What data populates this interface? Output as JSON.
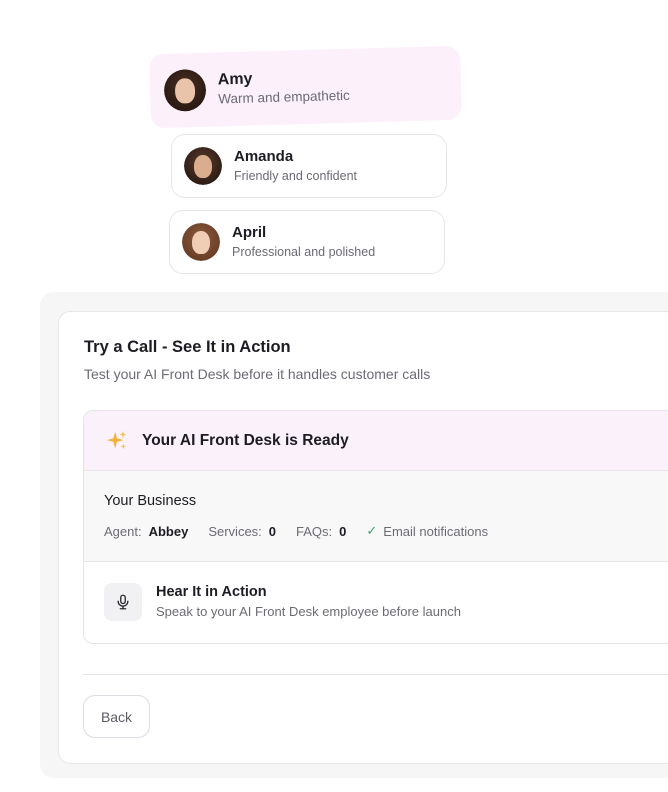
{
  "voices": [
    {
      "name": "Amy",
      "description": "Warm and empathetic",
      "selected": true
    },
    {
      "name": "Amanda",
      "description": "Friendly and confident",
      "selected": false
    },
    {
      "name": "April",
      "description": "Professional and polished",
      "selected": false
    }
  ],
  "panel": {
    "title": "Try a Call - See It in Action",
    "subtitle": "Test your AI Front Desk before it handles customer calls",
    "status": {
      "icon": "sparkle-icon",
      "title": "Your AI Front Desk is Ready"
    },
    "business": {
      "title": "Your Business",
      "agent_label": "Agent:",
      "agent_value": "Abbey",
      "services_label": "Services:",
      "services_value": "0",
      "faqs_label": "FAQs:",
      "faqs_value": "0",
      "email_label": "Email notifications"
    },
    "hear": {
      "icon": "microphone-icon",
      "title": "Hear It in Action",
      "description": "Speak to your AI Front Desk employee before launch"
    },
    "back_label": "Back"
  },
  "colors": {
    "selected_bg": "#fcf0fb",
    "check": "#3aa56b",
    "sparkle": "#f2b33d"
  }
}
